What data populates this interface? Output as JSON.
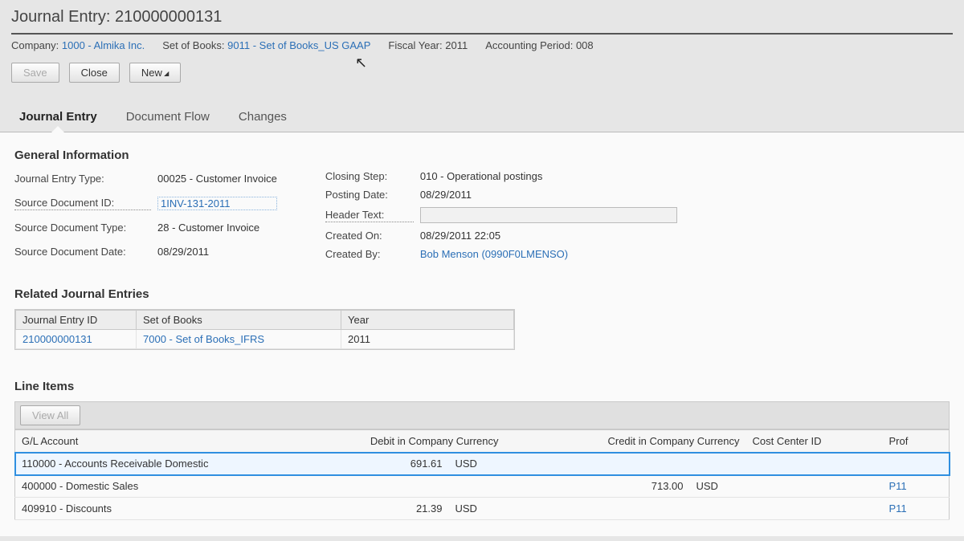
{
  "header": {
    "title": "Journal Entry: 210000000131",
    "company_label": "Company:",
    "company_value": "1000 - Almika Inc.",
    "sob_label": "Set of Books:",
    "sob_value": "9011 - Set of Books_US GAAP",
    "fy_label": "Fiscal Year:",
    "fy_value": "2011",
    "ap_label": "Accounting Period:",
    "ap_value": "008",
    "btn_save": "Save",
    "btn_close": "Close",
    "btn_new": "New"
  },
  "tabs": {
    "journal_entry": "Journal Entry",
    "document_flow": "Document Flow",
    "changes": "Changes"
  },
  "general": {
    "title": "General Information",
    "left": {
      "jet_label": "Journal Entry Type:",
      "jet_value": "00025 - Customer Invoice",
      "sdid_label": "Source Document ID:",
      "sdid_value": "1INV-131-2011",
      "sdt_label": "Source Document Type:",
      "sdt_value": "28 - Customer Invoice",
      "sdd_label": "Source Document Date:",
      "sdd_value": "08/29/2011"
    },
    "right": {
      "cs_label": "Closing Step:",
      "cs_value": "010 - Operational postings",
      "pd_label": "Posting Date:",
      "pd_value": "08/29/2011",
      "ht_label": "Header Text:",
      "co_label": "Created On:",
      "co_value": "08/29/2011 22:05",
      "cb_label": "Created By:",
      "cb_value": "Bob Menson (0990F0LMENSO)"
    }
  },
  "related": {
    "title": "Related Journal Entries",
    "col_id": "Journal Entry ID",
    "col_sob": "Set of Books",
    "col_year": "Year",
    "rows": [
      {
        "id": "210000000131",
        "sob": "7000 - Set of Books_IFRS",
        "year": "2011"
      }
    ]
  },
  "line_items": {
    "title": "Line Items",
    "view_all": "View All",
    "col_gl": "G/L Account",
    "col_debit": "Debit in Company Currency",
    "col_credit": "Credit in Company Currency",
    "col_cc": "Cost Center ID",
    "col_prof": "Prof",
    "rows": [
      {
        "gl": "110000 - Accounts Receivable Domestic",
        "debit": "691.61",
        "debit_cur": "USD",
        "credit": "",
        "credit_cur": "",
        "prof": ""
      },
      {
        "gl": "400000 - Domestic Sales",
        "debit": "",
        "debit_cur": "",
        "credit": "713.00",
        "credit_cur": "USD",
        "prof": "P11"
      },
      {
        "gl": "409910 - Discounts",
        "debit": "21.39",
        "debit_cur": "USD",
        "credit": "",
        "credit_cur": "",
        "prof": "P11"
      }
    ]
  }
}
